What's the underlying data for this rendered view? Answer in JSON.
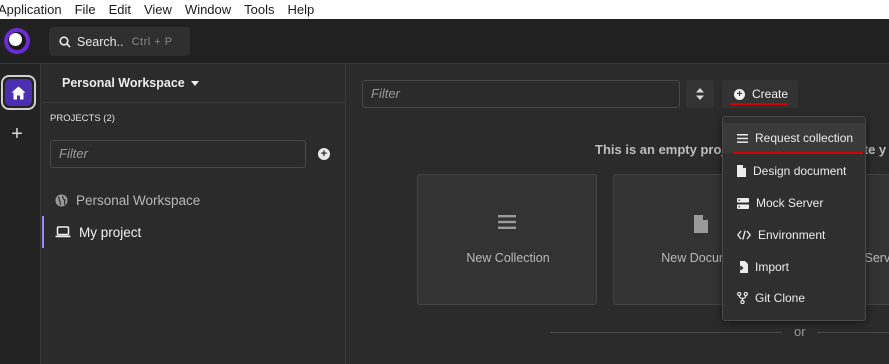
{
  "menubar": [
    "Application",
    "File",
    "Edit",
    "View",
    "Window",
    "Tools",
    "Help"
  ],
  "titlebar": {
    "search_label": "Search..",
    "search_shortcut": "Ctrl + P"
  },
  "sidebar": {
    "workspace": "Personal Workspace",
    "projects_label": "PROJECTS (2)",
    "filter_placeholder": "Filter",
    "items": [
      {
        "label": "Personal Workspace",
        "icon": "globe-icon"
      },
      {
        "label": "My project",
        "icon": "laptop-icon",
        "selected": true
      }
    ]
  },
  "main": {
    "filter_placeholder": "Filter",
    "create_label": "Create",
    "empty_text": "This is an empty project, to get started create y",
    "cards": [
      {
        "label": "New Collection",
        "icon": "list-icon"
      },
      {
        "label": "New Document",
        "icon": "document-icon"
      },
      {
        "label": "New Mock Server",
        "icon": "server-icon"
      }
    ],
    "or_label": "or"
  },
  "dropdown": {
    "items": [
      {
        "label": "Request collection",
        "icon": "list-icon",
        "highlighted": true
      },
      {
        "label": "Design document",
        "icon": "document-icon"
      },
      {
        "label": "Mock Server",
        "icon": "server-icon"
      },
      {
        "label": "Environment",
        "icon": "code-icon"
      },
      {
        "label": "Import",
        "icon": "import-icon"
      },
      {
        "label": "Git Clone",
        "icon": "git-branch-icon"
      }
    ]
  },
  "colors": {
    "accent": "#4b2fb0",
    "annotation": "#d40000",
    "selection": "#9c8cff"
  }
}
